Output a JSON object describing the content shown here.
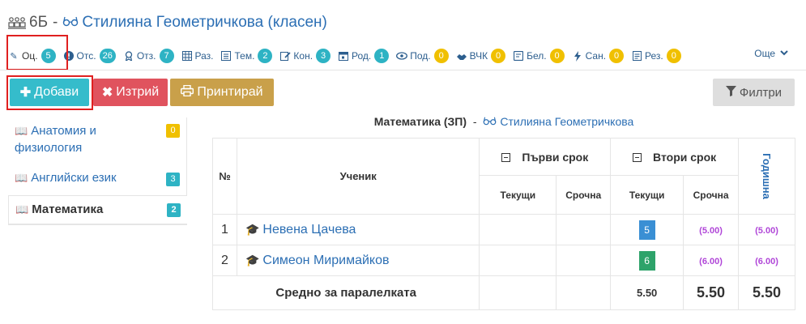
{
  "header": {
    "class_label": "6Б",
    "separator": "-",
    "teacher_name": "Стилияна Геометричкова (класен)"
  },
  "tabs": [
    {
      "label": "Оц.",
      "count": "5",
      "icon": "pencil-icon",
      "badge": "teal"
    },
    {
      "label": "Отс.",
      "count": "26",
      "icon": "exclamation-icon",
      "badge": "teal"
    },
    {
      "label": "Отз.",
      "count": "7",
      "icon": "award-icon",
      "badge": "teal"
    },
    {
      "label": "Раз.",
      "count": "",
      "icon": "grid-icon",
      "badge": ""
    },
    {
      "label": "Тем.",
      "count": "2",
      "icon": "list-icon",
      "badge": "teal"
    },
    {
      "label": "Кон.",
      "count": "3",
      "icon": "edit-icon",
      "badge": "teal"
    },
    {
      "label": "Род.",
      "count": "1",
      "icon": "calendar-icon",
      "badge": "teal"
    },
    {
      "label": "Под.",
      "count": "0",
      "icon": "eye-icon",
      "badge": "yellow"
    },
    {
      "label": "ВЧК",
      "count": "0",
      "icon": "handshake-icon",
      "badge": "yellow"
    },
    {
      "label": "Бел.",
      "count": "0",
      "icon": "note-icon",
      "badge": "yellow"
    },
    {
      "label": "Сан.",
      "count": "0",
      "icon": "bolt-icon",
      "badge": "yellow"
    },
    {
      "label": "Рез.",
      "count": "0",
      "icon": "document-icon",
      "badge": "yellow"
    }
  ],
  "more_label": "Още",
  "toolbar": {
    "add_label": "Добави",
    "delete_label": "Изтрий",
    "print_label": "Принтирай",
    "filter_label": "Филтри"
  },
  "subjects": [
    {
      "label": "Анатомия и физиология",
      "count": "0"
    },
    {
      "label": "Английски език",
      "count": "3"
    },
    {
      "label": "Математика",
      "count": "2"
    }
  ],
  "caption": {
    "subject": "Математика (ЗП)",
    "separator": "-",
    "teacher": "Стилияна Геометричкова"
  },
  "table": {
    "col_no": "№",
    "col_student": "Ученик",
    "term1": "Първи срок",
    "term2": "Втори срок",
    "current": "Текущи",
    "term_grade": "Срочна",
    "yearly": "Годишна",
    "rows": [
      {
        "no": "1",
        "name": "Невена Цачева",
        "t2_current": "5",
        "t2_term": "(5.00)",
        "yearly": "(5.00)"
      },
      {
        "no": "2",
        "name": "Симеон Миримайков",
        "t2_current": "6",
        "t2_term": "(6.00)",
        "yearly": "(6.00)"
      }
    ],
    "avg_label": "Средно за паралелката",
    "avg_t2_current": "5.50",
    "avg_t2_term": "5.50",
    "avg_yearly": "5.50"
  },
  "colors": {
    "accent_teal": "#35bccb",
    "danger": "#e0535e",
    "print": "#c9a04a",
    "link": "#2c6fb4",
    "grade_5": "#3a8fd4",
    "grade_6": "#2ea36a",
    "purple": "#b046d8"
  }
}
